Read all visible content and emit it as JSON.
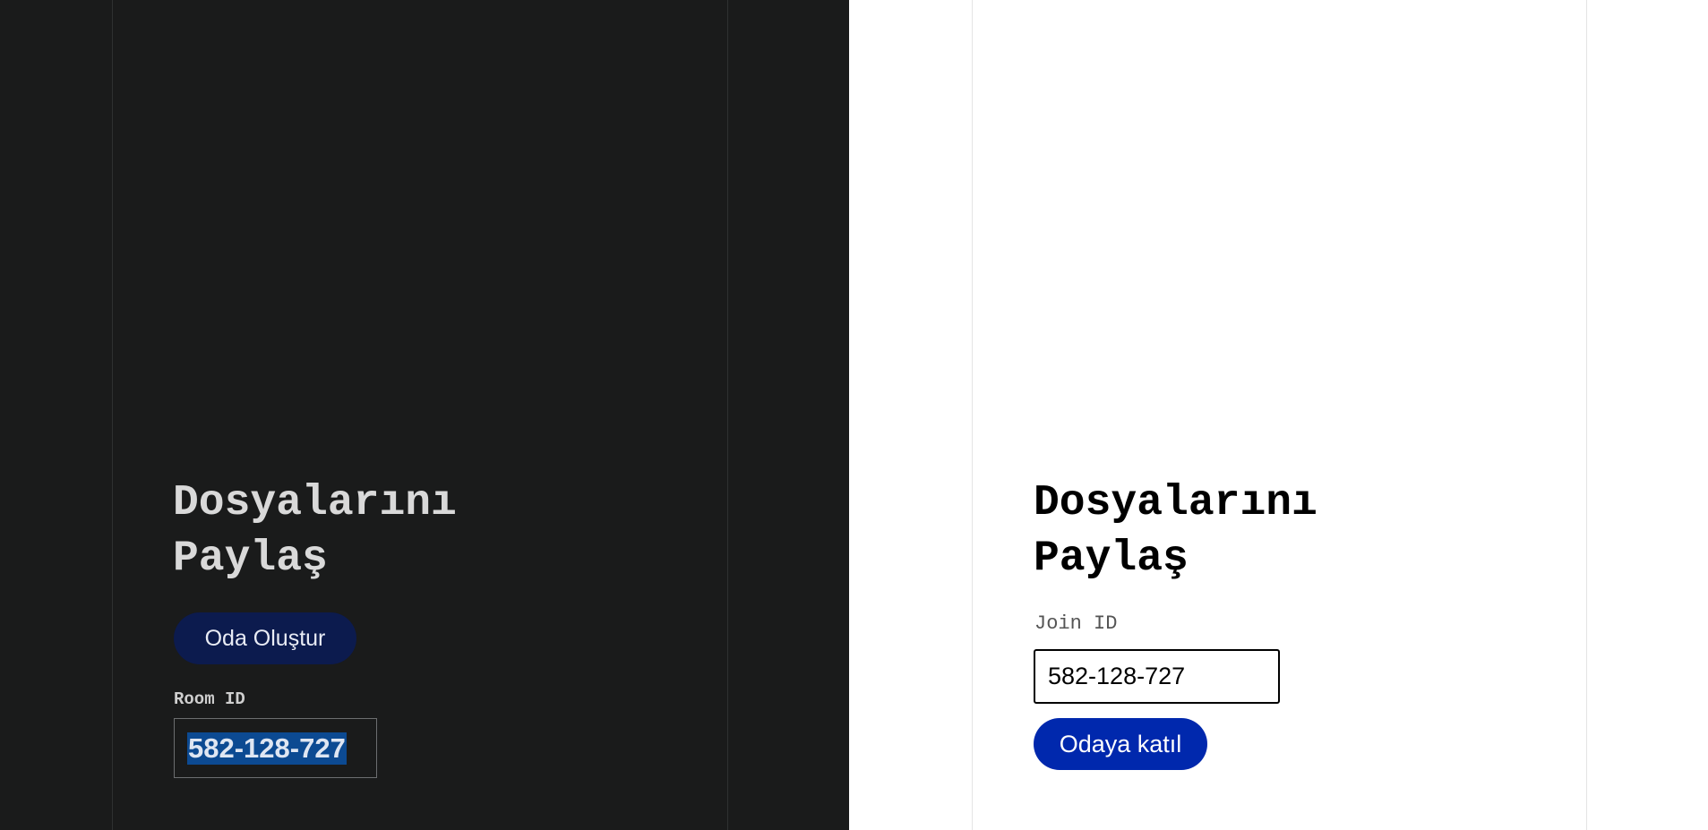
{
  "host_panel": {
    "title_line1": "Dosyalarını",
    "title_line2": "Paylaş",
    "create_button_label": "Oda Oluştur",
    "room_id_label": "Room ID",
    "room_id_value": "582-128-727"
  },
  "guest_panel": {
    "title_line1": "Dosyalarını",
    "title_line2": "Paylaş",
    "join_id_label": "Join ID",
    "join_input_value": "582-128-727",
    "join_button_label": "Odaya katıl"
  },
  "colors": {
    "dark_background": "#1a1b1b",
    "light_background": "#ffffff",
    "create_button": "#0c1b4e",
    "join_button": "#0028ad",
    "selection_highlight": "#0c4a92"
  }
}
